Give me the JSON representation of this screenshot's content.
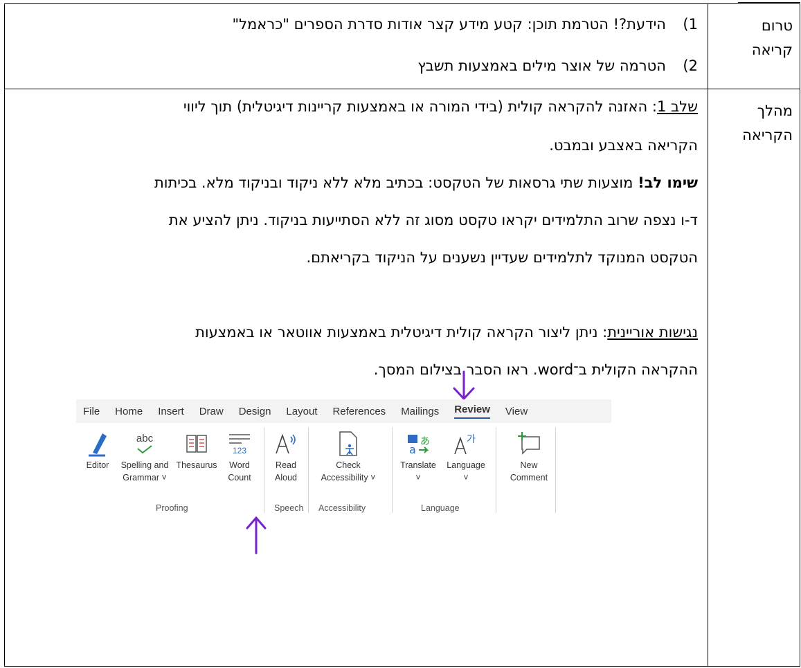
{
  "rows": [
    {
      "label": [
        "טרום",
        "קריאה"
      ],
      "items": [
        {
          "num": "1)",
          "text": "הידעת?! הטרמת תוכן: קטע מידע קצר אודות סדרת הספרים \"כראמל\""
        },
        {
          "num": "2)",
          "text": "הטרמה של אוצר מילים באמצעות תשבץ"
        }
      ]
    },
    {
      "label": [
        "מהלך",
        "הקריאה"
      ],
      "step1_label": "שלב 1",
      "step1_rest_line1": ":  האזנה להקראה קולית (בידי המורה או באמצעות קריינות דיגיטלית) תוך ליווי",
      "step1_line2": "הקריאה באצבע ובמבט.",
      "note_bold": "שימו לב!",
      "note_line1": " מוצעות שתי גרסאות של הטקסט: בכתיב מלא ללא ניקוד ובניקוד מלא. בכיתות",
      "note_line2": "ד-ו נצפה שרוב התלמידים יקראו טקסט מסוג זה ללא הסתייעות בניקוד. ניתן להציע את",
      "note_line3": "הטקסט המנוקד לתלמידים שעדיין נשענים על הניקוד בקריאתם.",
      "access_label": "נגישות אוריינית",
      "access_line1": ": ניתן ליצור הקראה קולית דיגיטלית באמצעות אווטאר או באמצעות",
      "access_line2": "ההקראה הקולית ב־word. ראו הסבר בצילום המסך."
    }
  ],
  "ribbon": {
    "tabs": [
      "File",
      "Home",
      "Insert",
      "Draw",
      "Design",
      "Layout",
      "References",
      "Mailings",
      "Review",
      "View"
    ],
    "active_tab": "Review",
    "tools": {
      "editor": "Editor",
      "spelling_1": "Spelling and",
      "spelling_2": "Grammar ˅",
      "spelling_icon_text": "abc",
      "thesaurus": "Thesaurus",
      "wordcount_1": "Word",
      "wordcount_2": "Count",
      "wordcount_icon_text": "123",
      "readaloud_1": "Read",
      "readaloud_2": "Aloud",
      "access_1": "Check",
      "access_2": "Accessibility ˅",
      "translate_1": "Translate",
      "translate_2": "˅",
      "language_1": "Language",
      "language_2": "˅",
      "comment_1": "New",
      "comment_2": "Comment"
    },
    "groups": {
      "proofing": "Proofing",
      "speech": "Speech",
      "accessibility": "Accessibility",
      "language": "Language"
    },
    "accent_color": "#2b579a",
    "annotation_color": "#7a22c9"
  }
}
